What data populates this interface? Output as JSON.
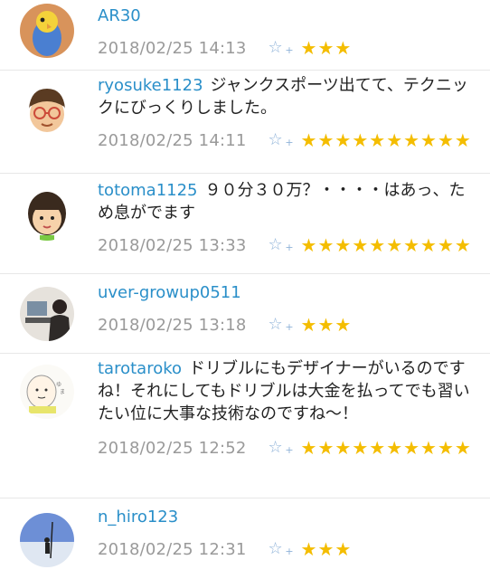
{
  "comments": [
    {
      "user": "AR30",
      "text": "",
      "date": "2018/02/25 14:13",
      "stars": "★★★",
      "avatar": "bird-avatar"
    },
    {
      "user": "ryosuke1123",
      "text": "ジャンクスポーツ出てて、テクニックにびっくりしました。",
      "date": "2018/02/25 14:11",
      "stars": "★★★★★★★★★★",
      "avatar": "glasses-man-avatar"
    },
    {
      "user": "totoma1125",
      "text": "９０分３０万？・・・・はあっ、ため息がでます",
      "date": "2018/02/25 13:33",
      "stars": "★★★★★★★★★★",
      "avatar": "girl-avatar"
    },
    {
      "user": "uver-growup0511",
      "text": "",
      "date": "2018/02/25 13:18",
      "stars": "★★★",
      "avatar": "photo-avatar"
    },
    {
      "user": "tarotaroko",
      "text": "ドリブルにもデザイナーがいるのですね！それにしてもドリブルは大金を払ってでも習いたい位に大事な技術なのですね～！",
      "date": "2018/02/25 12:52",
      "stars": "★★★★★★★★★★",
      "avatar": "baby-sketch-avatar"
    },
    {
      "user": "n_hiro123",
      "text": "",
      "date": "2018/02/25 12:31",
      "stars": "★★★",
      "avatar": "snow-photo-avatar"
    }
  ],
  "add_star_symbol": "☆",
  "add_star_plus": "+",
  "colors": {
    "username": "#2a8fc9",
    "star": "#f4bd00",
    "date": "#9a9a9a"
  }
}
